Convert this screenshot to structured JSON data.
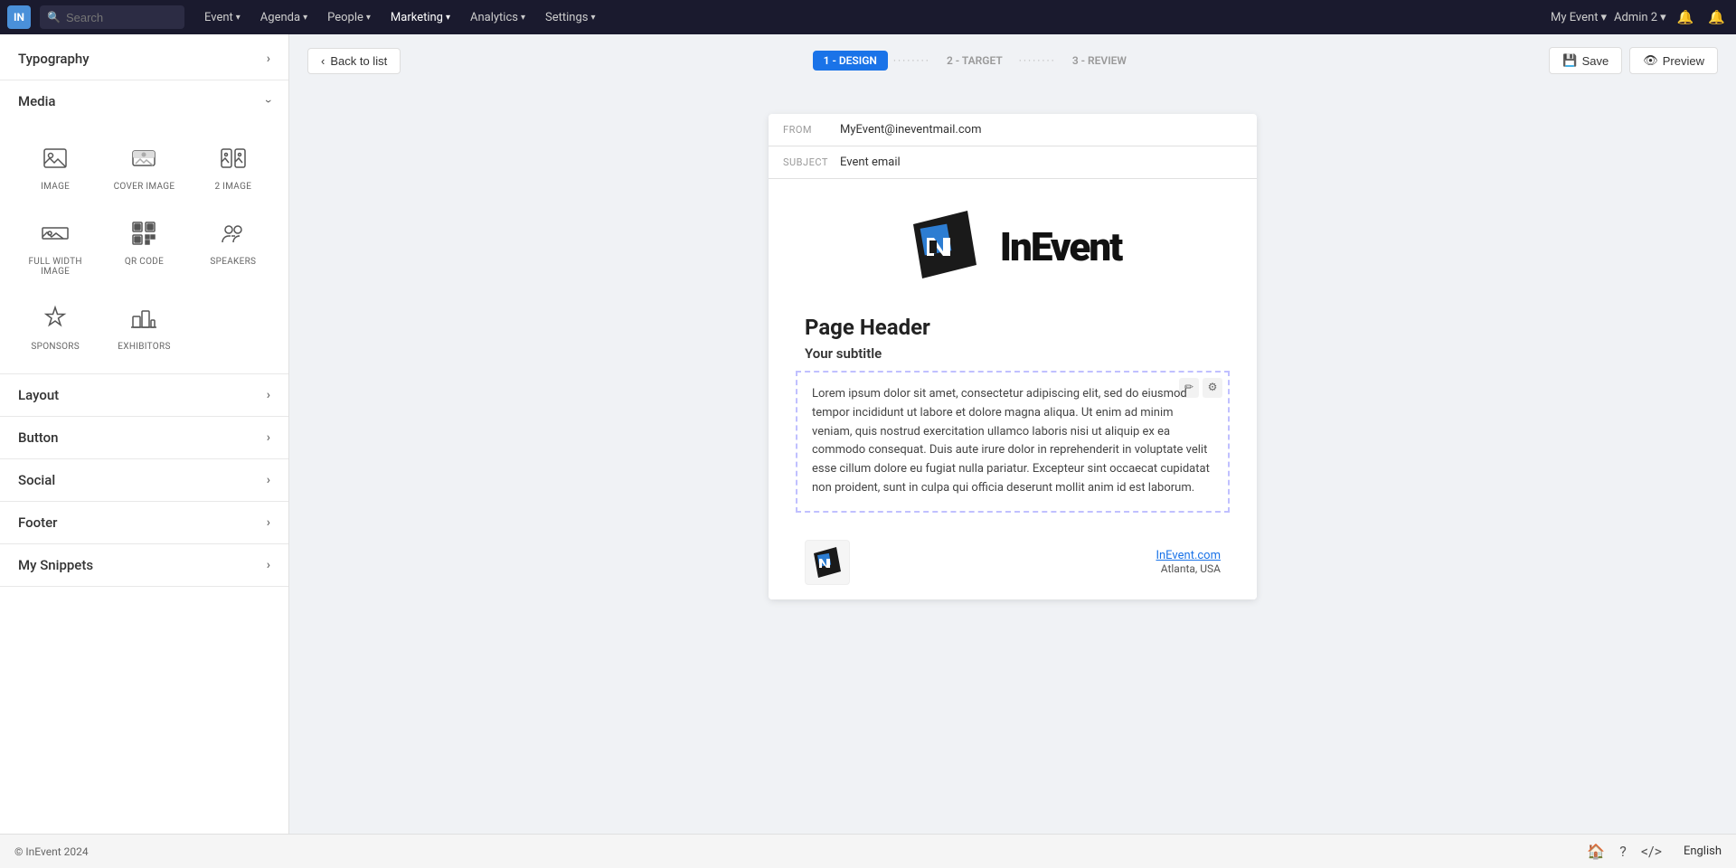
{
  "topNav": {
    "logo": "IN",
    "searchPlaceholder": "Search",
    "navItems": [
      {
        "label": "Event",
        "hasChevron": true
      },
      {
        "label": "Agenda",
        "hasChevron": true
      },
      {
        "label": "People",
        "hasChevron": true
      },
      {
        "label": "Marketing",
        "hasChevron": true,
        "active": true
      },
      {
        "label": "Analytics",
        "hasChevron": true
      },
      {
        "label": "Settings",
        "hasChevron": true
      }
    ],
    "myEvent": "My Event",
    "admin": "Admin 2"
  },
  "subHeader": {
    "backLabel": "Back to list",
    "steps": [
      {
        "label": "1 - DESIGN",
        "active": true
      },
      {
        "label": "2 - TARGET",
        "active": false
      },
      {
        "label": "3 - REVIEW",
        "active": false
      }
    ],
    "saveLabel": "Save",
    "previewLabel": "Preview"
  },
  "sidebar": {
    "sections": [
      {
        "label": "Typography",
        "expanded": false,
        "chevron": "›"
      },
      {
        "label": "Media",
        "expanded": true,
        "chevron": "›"
      },
      {
        "label": "Layout",
        "expanded": false,
        "chevron": "›"
      },
      {
        "label": "Button",
        "expanded": false,
        "chevron": "›"
      },
      {
        "label": "Social",
        "expanded": false,
        "chevron": "›"
      },
      {
        "label": "Footer",
        "expanded": false,
        "chevron": "›"
      },
      {
        "label": "My Snippets",
        "expanded": false,
        "chevron": "›"
      }
    ],
    "mediaItems": [
      {
        "label": "IMAGE",
        "icon": "image"
      },
      {
        "label": "COVER IMAGE",
        "icon": "cover-image"
      },
      {
        "label": "2 IMAGE",
        "icon": "two-image"
      },
      {
        "label": "FULL WIDTH IMAGE",
        "icon": "full-width-image"
      },
      {
        "label": "QR CODE",
        "icon": "qr-code"
      },
      {
        "label": "SPEAKERS",
        "icon": "speakers"
      },
      {
        "label": "SPONSORS",
        "icon": "sponsors"
      },
      {
        "label": "EXHIBITORS",
        "icon": "exhibitors"
      }
    ]
  },
  "email": {
    "fromLabel": "FROM",
    "fromValue": "MyEvent@ineventmail.com",
    "subjectLabel": "SUBJECT",
    "subjectValue": "Event email",
    "logoText": "InEvent",
    "pageHeader": "Page Header",
    "subtitle": "Your subtitle",
    "bodyText": "Lorem ipsum dolor sit amet, consectetur adipiscing elit, sed do eiusmod tempor incididunt ut labore et dolore magna aliqua. Ut enim ad minim veniam, quis nostrud exercitation ullamco laboris nisi ut aliquip ex ea commodo consequat. Duis aute irure dolor in reprehenderit in voluptate velit esse cillum dolore eu fugiat nulla pariatur. Excepteur sint occaecat cupidatat non proident, sunt in culpa qui officia deserunt mollit anim id est laborum.",
    "footerLink": "InEvent.com",
    "footerAddress": "Atlanta, USA"
  },
  "bottomBar": {
    "copyright": "© InEvent 2024",
    "language": "English"
  }
}
